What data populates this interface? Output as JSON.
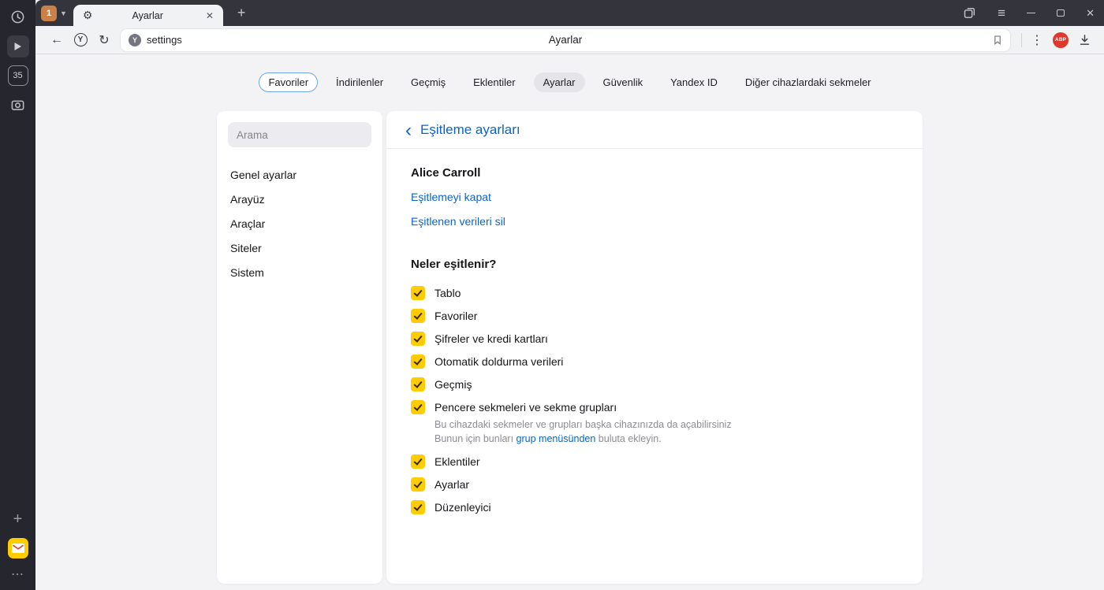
{
  "colors": {
    "accent_blue": "#0a64c8",
    "checkbox_yellow": "#ffcc00",
    "abp_red": "#e0372c",
    "rail_dark": "#26262e"
  },
  "icons": {
    "back": "←",
    "reload": "↻",
    "plus": "+",
    "new_tab": "+",
    "close": "✕",
    "menu": "≡",
    "dots_vertical": "⋮",
    "dots_horizontal": "⋯",
    "chevron_down": "▼",
    "chevron_left": "‹",
    "gear": "⚙",
    "y_letter": "Y"
  },
  "window": {
    "tab_group_count": "1",
    "active_tab_title": "Ayarlar",
    "rail_badge": "35"
  },
  "toolbar": {
    "address_text": "settings",
    "page_title": "Ayarlar",
    "abp_label": "ABP"
  },
  "nav": {
    "tabs": [
      {
        "label": "Favoriler"
      },
      {
        "label": "İndirilenler"
      },
      {
        "label": "Geçmiş"
      },
      {
        "label": "Eklentiler"
      },
      {
        "label": "Ayarlar"
      },
      {
        "label": "Güvenlik"
      },
      {
        "label": "Yandex ID"
      },
      {
        "label": "Diğer cihazlardaki sekmeler"
      }
    ]
  },
  "settings_sidebar": {
    "search_placeholder": "Arama",
    "items": [
      {
        "label": "Genel ayarlar"
      },
      {
        "label": "Arayüz"
      },
      {
        "label": "Araçlar"
      },
      {
        "label": "Siteler"
      },
      {
        "label": "Sistem"
      }
    ]
  },
  "sync": {
    "title": "Eşitleme ayarları",
    "account_name": "Alice Carroll",
    "link_disable": "Eşitlemeyi kapat",
    "link_delete": "Eşitlenen verileri sil",
    "section_title": "Neler eşitlenir?",
    "items": [
      {
        "label": "Tablo",
        "checked": true
      },
      {
        "label": "Favoriler",
        "checked": true
      },
      {
        "label": "Şifreler ve kredi kartları",
        "checked": true
      },
      {
        "label": "Otomatik doldurma verileri",
        "checked": true
      },
      {
        "label": "Geçmiş",
        "checked": true
      },
      {
        "label": "Pencere sekmeleri ve sekme grupları",
        "checked": true,
        "desc_line1": "Bu cihazdaki sekmeler ve grupları başka cihazınızda da açabilirsiniz",
        "desc_line2_pre": "Bunun için bunları ",
        "desc_link": "grup menüsünden",
        "desc_line2_post": " buluta ekleyin."
      },
      {
        "label": "Eklentiler",
        "checked": true
      },
      {
        "label": "Ayarlar",
        "checked": true
      },
      {
        "label": "Düzenleyici",
        "checked": true
      }
    ]
  }
}
